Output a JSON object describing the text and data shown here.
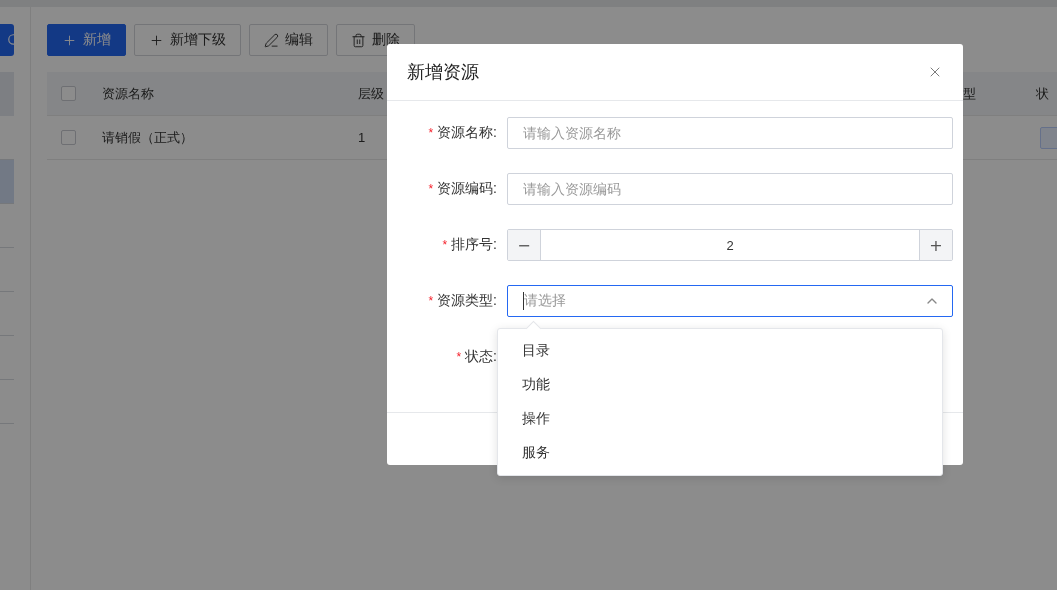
{
  "sidebar": {
    "items": [
      {
        "selected": false
      },
      {
        "selected": true
      },
      {
        "selected": false
      },
      {
        "selected": false
      },
      {
        "selected": false
      },
      {
        "selected": false
      },
      {
        "selected": false
      }
    ]
  },
  "toolbar": [
    {
      "label": "新增",
      "kind": "primary"
    },
    {
      "label": "新增下级",
      "kind": "default"
    },
    {
      "label": "编辑",
      "kind": "default"
    },
    {
      "label": "删除",
      "kind": "default"
    }
  ],
  "table": {
    "header_checked": false,
    "columns": [
      "资源名称",
      "层级",
      "型",
      "状"
    ],
    "rows": [
      {
        "checked": false,
        "name": "请销假（正式）",
        "level_text": "1",
        "status_tag": true
      }
    ]
  },
  "dialog": {
    "title": "新增资源",
    "fields": [
      {
        "kind": "text",
        "label": "资源名称:",
        "required_mark": "*",
        "placeholder": "请输入资源名称"
      },
      {
        "kind": "text",
        "label": "资源编码:",
        "required_mark": "*",
        "placeholder": "请输入资源编码"
      },
      {
        "kind": "number",
        "label": "排序号:",
        "required_mark": "*",
        "value": "2",
        "minus": "−",
        "plus": "+"
      },
      {
        "kind": "select",
        "label": "资源类型:",
        "required_mark": "*",
        "placeholder": "请选择",
        "open": true,
        "options": [
          {
            "label": "目录",
            "selected": false
          },
          {
            "label": "功能",
            "selected": false
          },
          {
            "label": "操作",
            "selected": false
          },
          {
            "label": "服务",
            "selected": false
          }
        ]
      },
      {
        "kind": "status",
        "label": "状态:",
        "required_mark": "*"
      }
    ]
  }
}
